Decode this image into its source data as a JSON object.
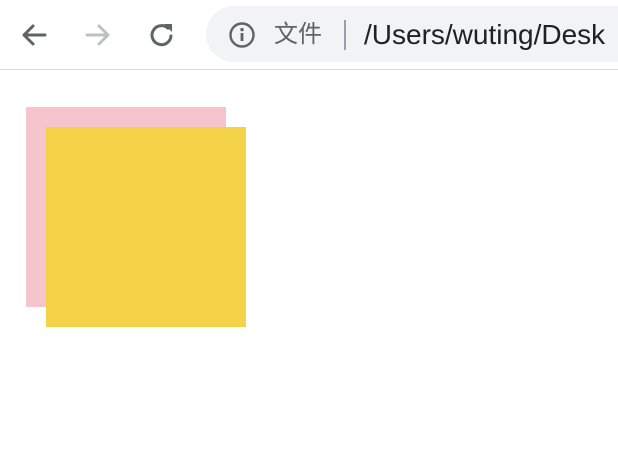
{
  "toolbar": {
    "back_icon": "arrow-left-icon",
    "forward_icon": "arrow-right-icon",
    "reload_icon": "reload-icon",
    "colors": {
      "active_icon": "#5f6368",
      "disabled_icon": "#bdc1c6",
      "omnibox_bg": "#f1f3f4"
    }
  },
  "omnibox": {
    "info_icon": "info-icon",
    "scheme_label": "文件",
    "url": "/Users/wuting/Desk"
  },
  "content": {
    "boxes": [
      {
        "name": "pink-square",
        "color": "#f5c4cc"
      },
      {
        "name": "yellow-square",
        "color": "#f4d349"
      }
    ]
  }
}
